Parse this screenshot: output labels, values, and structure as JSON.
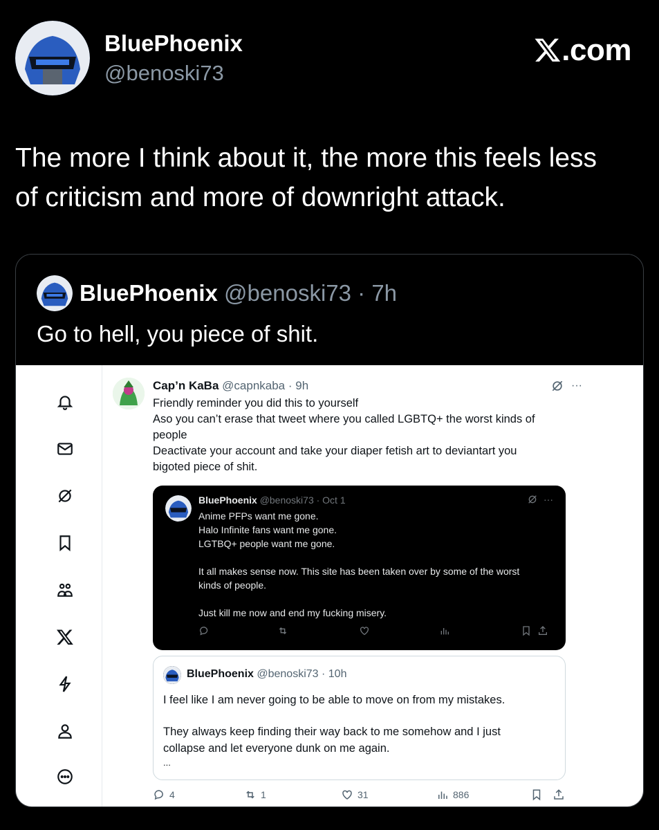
{
  "header": {
    "display_name": "BluePhoenix",
    "handle": "@benoski73",
    "brand": ".com"
  },
  "post": {
    "text_line1": "The more I think about it, the more this feels less",
    "text_line2": "of criticism and more of downright attack."
  },
  "quoted_post": {
    "display_name": "BluePhoenix",
    "handle_time": "@benoski73 · 7h",
    "text": "Go to hell, you piece of shit."
  },
  "screenshot": {
    "sidebar": [
      "bell-icon",
      "mail-icon",
      "grok-icon",
      "bookmark-icon",
      "communities-icon",
      "x-logo-icon",
      "verified-icon",
      "profile-icon",
      "more-icon"
    ],
    "tweet": {
      "display_name": "Cap’n KaBa",
      "handle_time": "@capnkaba · 9h",
      "line1": "Friendly reminder you did this to yourself",
      "line2": "Aso you can’t erase that tweet where you called LGBTQ+ the worst kinds of",
      "line3": "people",
      "line4": "Deactivate your account and take your diaper fetish art to deviantart you",
      "line5": "bigoted piece of shit.",
      "more_label": "···"
    },
    "dark_quote": {
      "display_name": "BluePhoenix",
      "handle_time": "@benoski73 · Oct 1",
      "line1": "Anime PFPs want me gone.",
      "line2": "Halo Infinite fans want me gone.",
      "line3": "LGTBQ+ people want me gone.",
      "line4": "It all makes sense now. This site has been taken over by some of the worst",
      "line5": "kinds of people.",
      "line6": "Just kill me now and end my fucking misery.",
      "more_label": "···"
    },
    "light_quote": {
      "display_name": "BluePhoenix",
      "handle_time": "@benoski73 · 10h",
      "line1": "I feel like I am never going to be able to move on from my mistakes.",
      "line2": "They always keep finding their way back to me somehow and I just",
      "line3": "collapse and let everyone dunk on me again.",
      "line4": "..."
    },
    "actions": {
      "replies": "4",
      "reposts": "1",
      "likes": "31",
      "views": "886"
    }
  }
}
